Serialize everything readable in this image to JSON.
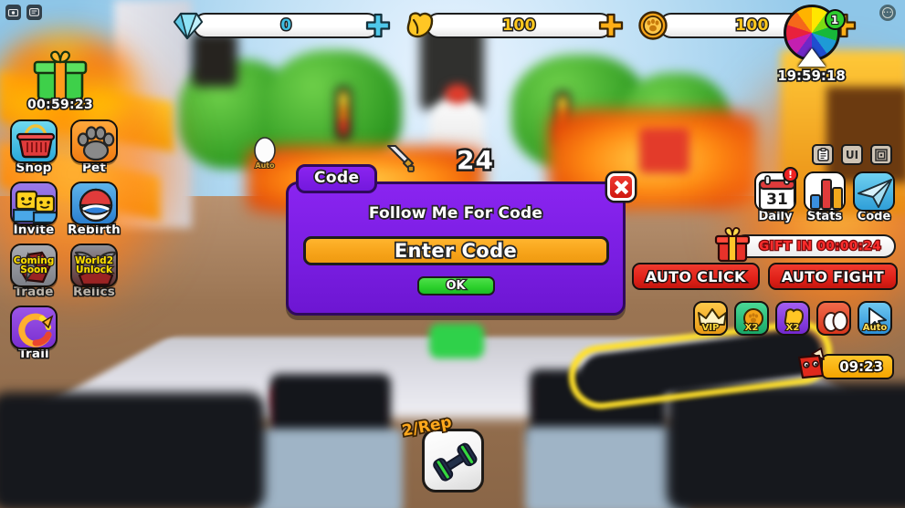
{
  "window": {
    "roblox_icons": [
      "camera-icon",
      "chat-icon"
    ],
    "menu_icon": "roblox-menu-icon"
  },
  "currencies": [
    {
      "id": "gems",
      "icon": "gem-icon",
      "value": "0",
      "plus": "+"
    },
    {
      "id": "strength",
      "icon": "muscle-icon",
      "value": "100",
      "plus": "+"
    },
    {
      "id": "coins",
      "icon": "coin-icon",
      "value": "100",
      "plus": "+"
    }
  ],
  "left_sidebar": {
    "gift": {
      "icon": "gift-box-icon",
      "timer": "00:59:23"
    },
    "buttons": [
      {
        "id": "shop",
        "label": "Shop",
        "icon": "basket-icon",
        "overlay": "",
        "dim": false
      },
      {
        "id": "pet",
        "label": "Pet",
        "icon": "paw-icon",
        "overlay": "",
        "dim": false
      },
      {
        "id": "invite",
        "label": "Invite",
        "icon": "friends-icon",
        "overlay": "",
        "dim": false
      },
      {
        "id": "rebirth",
        "label": "Rebirth",
        "icon": "pokeball-icon",
        "overlay": "",
        "dim": false
      },
      {
        "id": "trade",
        "label": "Trade",
        "icon": "rock-icon",
        "overlay": "Coming\nSoon",
        "dim": true
      },
      {
        "id": "relics",
        "label": "Relics",
        "icon": "wings-icon",
        "overlay": "World2\nUnlock",
        "dim": true
      },
      {
        "id": "trail",
        "label": "Trail",
        "icon": "trail-icon",
        "overlay": "",
        "dim": false
      }
    ]
  },
  "center_hud": {
    "damage_icon": "sword-icon",
    "damage_value": "24",
    "egg_icon": "egg-icon",
    "egg_label": "Auto"
  },
  "right_sidebar": {
    "wheel": {
      "icon": "color-wheel-icon",
      "badge": "1",
      "timer": "19:59:18"
    },
    "mini_icons": [
      {
        "id": "quests",
        "icon": "clipboard-icon",
        "glyph": ""
      },
      {
        "id": "ui",
        "icon": "ui-toggle-icon",
        "glyph": "UI"
      },
      {
        "id": "maze",
        "icon": "maze-icon",
        "glyph": ""
      }
    ],
    "buttons": [
      {
        "id": "daily",
        "label": "Daily",
        "icon": "calendar-icon",
        "day": "31",
        "badge": "!"
      },
      {
        "id": "stats",
        "label": "Stats",
        "icon": "bar-chart-icon",
        "day": "",
        "badge": ""
      },
      {
        "id": "code",
        "label": "Code",
        "icon": "paper-plane-icon",
        "day": "",
        "badge": ""
      }
    ],
    "gift_timer": {
      "icon": "gift-present-icon",
      "text": "GIFT IN 00:00:24"
    },
    "auto_buttons": [
      {
        "id": "auto-click",
        "label": "AUTO CLICK"
      },
      {
        "id": "auto-fight",
        "label": "AUTO FIGHT"
      }
    ],
    "boosts": [
      {
        "id": "vip",
        "icon": "crown-icon",
        "tag": "VIP",
        "color": "#f0a91c"
      },
      {
        "id": "coins-x2",
        "icon": "coin-icon",
        "tag": "X2",
        "color": "#2fc47a"
      },
      {
        "id": "strength-x2",
        "icon": "muscle-icon",
        "tag": "X2",
        "color": "#8b3fe0"
      },
      {
        "id": "eggs",
        "icon": "eggs-icon",
        "tag": "",
        "color": "#e8503a"
      },
      {
        "id": "auto-clicker",
        "icon": "cursor-icon",
        "tag": "Auto",
        "color": "#3aa6e8"
      }
    ],
    "pet_timer": {
      "icon": "red-pet-icon",
      "text": "09:23"
    }
  },
  "item_card": {
    "tag": "2/Rep",
    "icon": "dumbbell-icon"
  },
  "modal": {
    "tab_label": "Code",
    "title": "Follow Me For Code",
    "input_placeholder": "Enter Code",
    "input_value": "",
    "ok_label": "OK",
    "close_icon": "close-x-icon",
    "accent": "#7a1ee2",
    "input_color": "#f7a41a",
    "ok_color": "#2bcf2b"
  }
}
